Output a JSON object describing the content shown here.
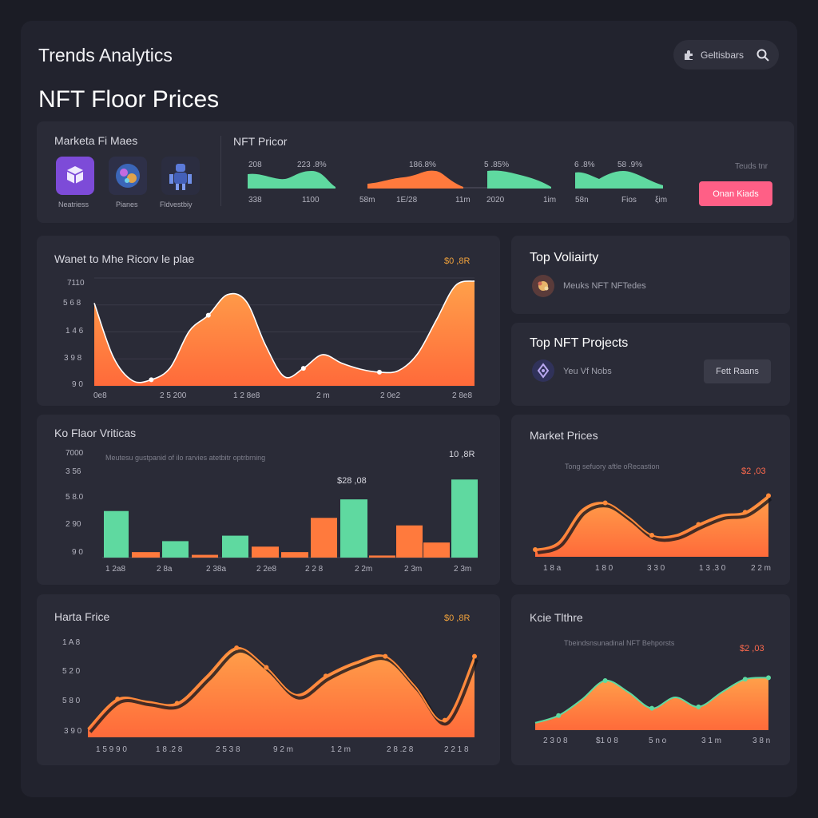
{
  "header": {
    "app_title": "Trends Analytics",
    "page_title": "NFT Floor Prices",
    "search_label": "Geltisbars"
  },
  "colors": {
    "background": "#1b1c25",
    "panel": "#2a2b37",
    "orange": "#ff7a3d",
    "green": "#5fd9a0",
    "pink_button": "#ff5f86",
    "accent_value": "#f1a23b"
  },
  "overview": {
    "markets_title": "Marketa Fi Maes",
    "tiles": [
      {
        "label": "Neatriess",
        "icon": "cube-icon"
      },
      {
        "label": "Pianes",
        "icon": "nft-art-icon"
      },
      {
        "label": "Fldvestbiy",
        "icon": "robot-icon"
      }
    ],
    "price_title": "NFT Pricor",
    "spark_values": [
      "208",
      "223 .8%",
      "186.8%",
      "5 .85%",
      "6 .8%",
      "58 .9%"
    ],
    "spark_ticks": [
      "338",
      "1100",
      "58m",
      "1E/28",
      "11m",
      "2020",
      "1im",
      "58n",
      "Fios",
      "ξim"
    ],
    "side_label": "Teuds tnr",
    "button_label": "Onan Kiads"
  },
  "top_volatility": {
    "title": "Top Voliairty",
    "row_label": "Meuks NFT NFTedes"
  },
  "top_projects": {
    "title": "Top NFT Projects",
    "row_label": "Yeu Vf Nobs",
    "button_label": "Fett Raans"
  },
  "chart_data": [
    {
      "type": "area",
      "title": "Wanet to Mhe Ricorv le plae",
      "value_label": "$0 ,8R",
      "yticks": [
        "7110",
        "5 6 8",
        "1 4 6",
        "3 9 8",
        "9 0"
      ],
      "xticks": [
        "0e8",
        "2 5 200",
        "1 2 8e8",
        "2 m",
        "2 0e2",
        "2 8e8"
      ],
      "ylim": [
        0,
        7100
      ],
      "x": [
        0,
        1,
        2,
        3,
        4,
        5,
        6,
        7,
        8,
        9,
        10,
        11,
        12,
        13,
        14,
        15,
        16,
        17,
        18,
        19,
        20,
        21,
        22,
        23,
        24
      ],
      "values": [
        5450,
        1900,
        350,
        400,
        1200,
        3600,
        4650,
        6000,
        5550,
        2700,
        600,
        1150,
        2050,
        1500,
        1100,
        900,
        1000,
        2100,
        4350,
        6600,
        6900,
        6900,
        6900,
        6900,
        6900
      ]
    },
    {
      "type": "bar",
      "title": "Ko Flaor Vriticas",
      "subtitle": "Meutesu gustpanid of ilo rarvies atetbitr optrbrning",
      "value_label": "10 ,8R",
      "annotation": "$28 ,08",
      "yticks": [
        "7000",
        "3 56",
        "5 8.0",
        "2 90",
        "9 0"
      ],
      "xticks": [
        "1 2a8",
        "2 8a",
        "2 38a",
        "2 2e8",
        "2 2 8",
        "2 2m",
        "2 3m",
        "2 3m"
      ],
      "ylim": [
        0,
        7000
      ],
      "values": [
        3400,
        400,
        1200,
        200,
        1600,
        800,
        400,
        2900,
        4250,
        150,
        2350,
        1100,
        5700
      ],
      "colors": [
        "green",
        "orange",
        "green",
        "orange",
        "green",
        "orange",
        "orange",
        "orange",
        "green",
        "orange",
        "orange",
        "orange",
        "green"
      ]
    },
    {
      "type": "area",
      "title": "Market Prices",
      "subtitle": "Tong sefuory aftle oRecastion",
      "value_label": "$2 ,03",
      "xticks": [
        "1 8 a",
        "1 8 0",
        "3 3 0",
        "1 3 .3 0",
        "2 2 m"
      ],
      "values": [
        10,
        20,
        65,
        75,
        55,
        30,
        30,
        45,
        58,
        62,
        85
      ]
    },
    {
      "type": "area",
      "title": "Harta Frice",
      "value_label": "$0 ,8R",
      "yticks": [
        "1 A 8",
        "5 2 0",
        "5 8 0",
        "3 9 0"
      ],
      "xticks": [
        "1 5 9 9 0",
        "1 8 .2 8",
        "2 5 3 8",
        "9 2 m",
        "1 2 m",
        "2 8 .2 8",
        "2 2 1 8"
      ],
      "values": [
        10,
        45,
        42,
        40,
        72,
        105,
        82,
        50,
        72,
        88,
        95,
        60,
        20,
        95
      ]
    },
    {
      "type": "area",
      "title": "Kcie Tlthre",
      "subtitle": "Tbeindsnsunadinal NFT Behporsts",
      "value_label": "$2 ,03",
      "xticks": [
        "2 3 0 8",
        "$1 0 8",
        "5 n o",
        "3 1 m",
        "3 8 n"
      ],
      "values": [
        10,
        20,
        42,
        68,
        52,
        30,
        45,
        32,
        52,
        70,
        72
      ]
    }
  ]
}
